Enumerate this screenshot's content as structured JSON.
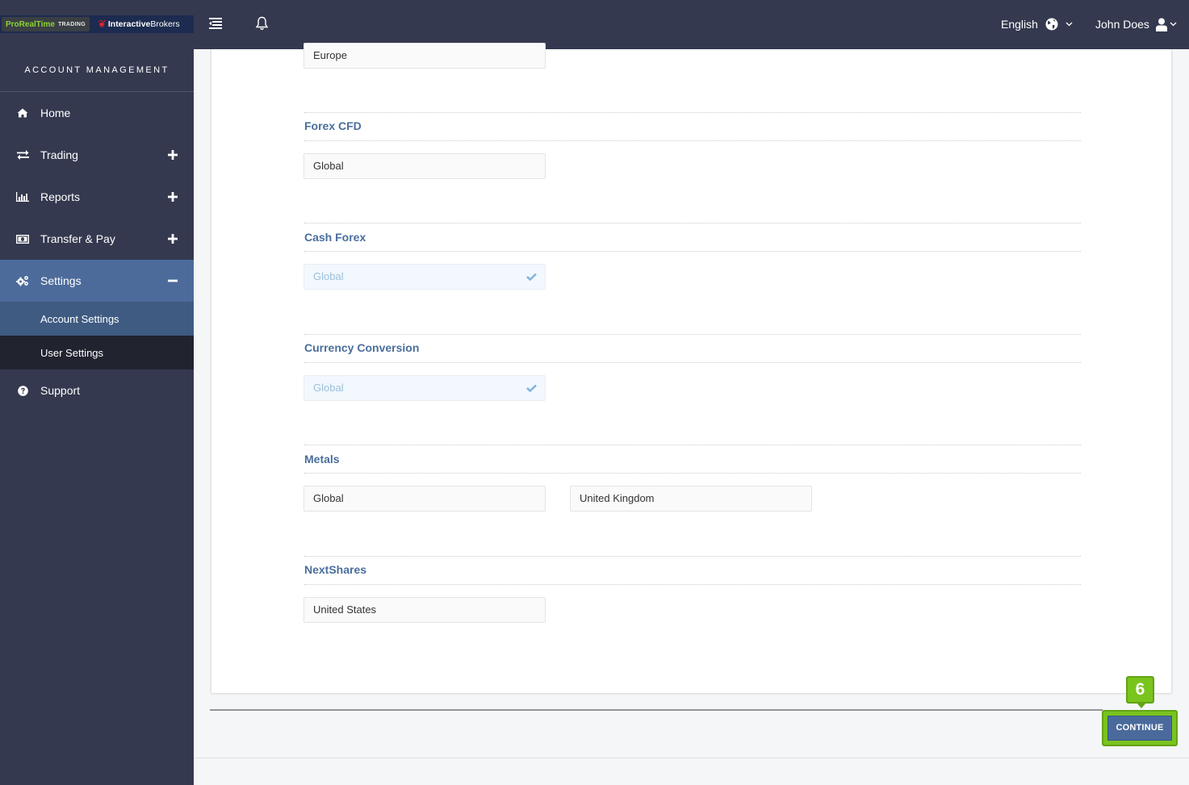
{
  "header": {
    "logo_prt": "ProRealTime",
    "logo_prt_sub": "TRADING",
    "logo_ib_bold": "Interactive",
    "logo_ib_rest": "Brokers",
    "language": "English",
    "user_name": "John Does"
  },
  "sidebar": {
    "title": "ACCOUNT MANAGEMENT",
    "items": [
      {
        "label": "Home",
        "icon": "home-icon"
      },
      {
        "label": "Trading",
        "icon": "exchange-icon",
        "toggle": "+"
      },
      {
        "label": "Reports",
        "icon": "bar-chart-icon",
        "toggle": "+"
      },
      {
        "label": "Transfer & Pay",
        "icon": "money-icon",
        "toggle": "+"
      },
      {
        "label": "Settings",
        "icon": "gears-icon",
        "toggle": "−"
      },
      {
        "label": "Support",
        "icon": "question-icon"
      }
    ],
    "sub_items": [
      {
        "label": "Account Settings"
      },
      {
        "label": "User Settings"
      }
    ]
  },
  "sections": {
    "top_field": "Europe",
    "forex_cfd": {
      "title": "Forex CFD",
      "values": [
        "Global"
      ]
    },
    "cash_forex": {
      "title": "Cash Forex",
      "values": [
        "Global"
      ],
      "locked": true
    },
    "currency_conversion": {
      "title": "Currency Conversion",
      "values": [
        "Global"
      ],
      "locked": true
    },
    "metals": {
      "title": "Metals",
      "values": [
        "Global",
        "United Kingdom"
      ]
    },
    "nextshares": {
      "title": "NextShares",
      "values": [
        "United States"
      ]
    }
  },
  "footer": {
    "continue_label": "CONTINUE",
    "step_badge": "6"
  },
  "colors": {
    "topbar": "#34394f",
    "active_nav": "#4c6b9b",
    "section_title": "#4a6e9c",
    "button": "#4a6a9c",
    "highlight": "#7ac41e"
  }
}
